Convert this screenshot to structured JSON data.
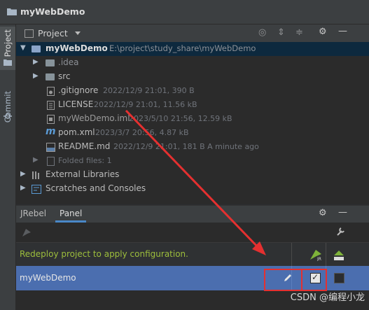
{
  "window": {
    "title": "myWebDemo"
  },
  "left_strip": {
    "project_label": "Project",
    "commit_label": "Commit"
  },
  "project_view": {
    "view_label": "Project",
    "root": {
      "name": "myWebDemo",
      "path": "E:\\project\\study_share\\myWebDemo"
    },
    "tree": [
      {
        "name": ".idea",
        "meta": ""
      },
      {
        "name": "src",
        "meta": ""
      },
      {
        "name": ".gitignore",
        "meta": "2022/12/9 21:01, 390 B"
      },
      {
        "name": "LICENSE",
        "meta": "2022/12/9 21:01, 11.56 kB"
      },
      {
        "name": "myWebDemo.iml",
        "meta": "2023/5/10 21:56, 12.59 kB"
      },
      {
        "name": "pom.xml",
        "meta": "2023/3/7 20:56, 4.87 kB"
      },
      {
        "name": "README.md",
        "meta": "2022/12/9 21:01, 181 B A minute ago"
      },
      {
        "name": "Folded files: 1",
        "meta": ""
      }
    ],
    "external_libraries": "External Libraries",
    "scratches": "Scratches and Consoles"
  },
  "panel": {
    "tabs": [
      "JRebel",
      "Panel"
    ],
    "active_tab": "Panel",
    "notice": "Redeploy project to apply configuration.",
    "project_row": {
      "name": "myWebDemo",
      "checkbox_checked": true
    }
  },
  "watermark": "CSDN @编程小龙",
  "colors": {
    "accent": "#4b6eaf",
    "notice_text": "#9dbe3c",
    "highlight": "#e53030"
  }
}
